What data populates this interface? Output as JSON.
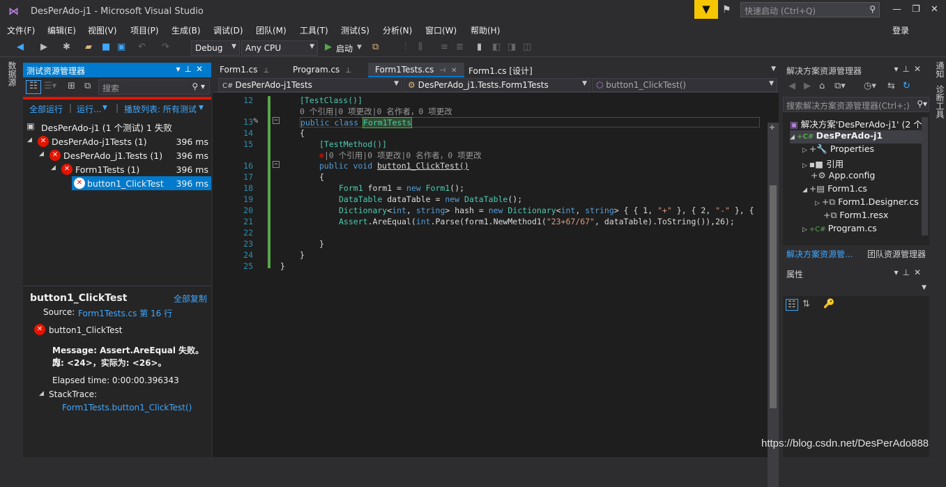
{
  "window": {
    "title": "DesPerAdo-j1 - Microsoft Visual Studio",
    "quick_launch_placeholder": "快速启动 (Ctrl+Q)",
    "signin": "登录"
  },
  "menu": [
    "文件(F)",
    "编辑(E)",
    "视图(V)",
    "项目(P)",
    "生成(B)",
    "调试(D)",
    "团队(M)",
    "工具(T)",
    "测试(S)",
    "分析(N)",
    "窗口(W)",
    "帮助(H)"
  ],
  "toolbar": {
    "config": "Debug",
    "platform": "Any CPU",
    "start": "启动"
  },
  "left_strip": "数据源",
  "test_explorer": {
    "title": "测试资源管理器",
    "search_placeholder": "搜索",
    "run_all": "全部运行",
    "run": "运行...",
    "playlist": "播放列表: 所有测试",
    "summary": "DesPerAdo-j1 (1 个测试) 1 失败",
    "tree": [
      {
        "label": "DesPerAdo-j1Tests (1)",
        "ms": "396 ms"
      },
      {
        "label": "DesPerAdo_j1.Tests (1)",
        "ms": "396 ms"
      },
      {
        "label": "Form1Tests (1)",
        "ms": "396 ms"
      },
      {
        "label": "button1_ClickTest",
        "ms": "396 ms"
      }
    ],
    "detail": {
      "name": "button1_ClickTest",
      "copy_all": "全部复制",
      "source_label": "Source:",
      "source_link": "Form1Tests.cs 第 16 行",
      "test_name": "button1_ClickTest",
      "message_1": "Message: Assert.AreEqual 失败。应",
      "message_2": "为: <24>，实际为: <26>。",
      "elapsed": "Elapsed time: 0:00:00.396343",
      "stacktrace": "StackTrace:",
      "stack_link": "Form1Tests.button1_ClickTest()"
    }
  },
  "editor": {
    "tabs": [
      "Form1.cs",
      "Program.cs",
      "Form1Tests.cs",
      "Form1.cs [设计]"
    ],
    "nav": [
      "DesPerAdo-j1Tests",
      "DesPerAdo_j1.Tests.Form1Tests",
      "button1_ClickTest()"
    ],
    "line_numbers": [
      "12",
      "",
      "13",
      "14",
      "15",
      "",
      "16",
      "17",
      "18",
      "19",
      "20",
      "21",
      "22",
      "23",
      "24",
      "25"
    ],
    "lines": {
      "l12": "[TestClass()]",
      "l12b": "0 个引用|0 项更改|0 名作者，0 项更改",
      "l13a": "public class ",
      "l13b": "Form1Tests",
      "l14": "{",
      "l15": "[TestMethod()]",
      "l15b": "|0 个引用|0 项更改|0 名作者，0 项更改",
      "l16a": "public void ",
      "l16b": "button1_ClickTest()",
      "l17": "{",
      "l18a": "Form1",
      "l18b": " form1 = ",
      "l18c": "new ",
      "l18d": "Form1",
      "l18e": "();",
      "l19a": "DataTable",
      "l19b": " dataTable = ",
      "l19c": "new ",
      "l19d": "DataTable",
      "l19e": "();",
      "l20a": "Dictionary",
      "l20b": "<",
      "l20c": "int",
      "l20d": ", ",
      "l20e": "string",
      "l20f": "> hash = ",
      "l20g": "new ",
      "l20h": "Dictionary",
      "l20i": "<",
      "l20j": "int",
      "l20k": ", ",
      "l20l": "string",
      "l20m": "> { { 1, ",
      "l20n": "\"+\"",
      "l20o": " }, { 2, ",
      "l20p": "\"-\"",
      "l20q": " }, {",
      "l21a": "Assert",
      "l21b": ".AreEqual(",
      "l21c": "int",
      "l21d": ".Parse(form1.NewMethod1(",
      "l21e": "\"23+67/67\"",
      "l21f": ", dataTable).ToString()),26);",
      "l23": "}",
      "l24": "}",
      "l25": "}"
    }
  },
  "solution_explorer": {
    "title": "解决方案资源管理器",
    "search_placeholder": "搜索解决方案资源管理器(Ctrl+;)",
    "items": [
      "解决方案'DesPerAdo-j1' (2 个",
      "DesPerAdo-j1",
      "Properties",
      "引用",
      "App.config",
      "Form1.cs",
      "Form1.Designer.cs",
      "Form1.resx",
      "Program.cs"
    ],
    "tab1": "解决方案资源管...",
    "tab2": "团队资源管理器"
  },
  "properties": {
    "title": "属性"
  },
  "right_strip": [
    "通知",
    "诊断工具"
  ],
  "watermark": "https://blog.csdn.net/DesPerAdo888"
}
